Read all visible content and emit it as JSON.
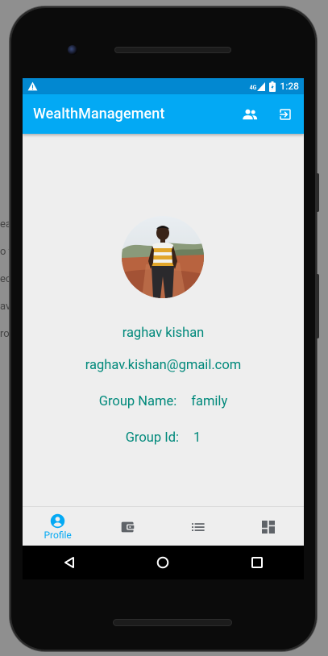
{
  "background_fragments": [
    "ea",
    "o t",
    "ec",
    "av",
    "ro"
  ],
  "status_bar": {
    "network": "4G",
    "time": "1:28"
  },
  "app_bar": {
    "title": "WealthManagement",
    "actions": [
      "group-icon",
      "logout-icon"
    ]
  },
  "profile": {
    "name": "raghav kishan",
    "email": "raghav.kishan@gmail.com",
    "group_name_label": "Group Name:",
    "group_name_value": "family",
    "group_id_label": "Group Id:",
    "group_id_value": "1"
  },
  "bottom_nav": {
    "items": [
      {
        "label": "Profile",
        "icon": "account-circle-icon",
        "active": true
      },
      {
        "label": "",
        "icon": "wallet-icon",
        "active": false
      },
      {
        "label": "",
        "icon": "list-icon",
        "active": false
      },
      {
        "label": "",
        "icon": "dashboard-icon",
        "active": false
      }
    ]
  },
  "colors": {
    "primary": "#03a9f4",
    "primary_dark": "#0288d1",
    "text_accent": "#00897b",
    "icon_inactive": "#5f6368"
  }
}
